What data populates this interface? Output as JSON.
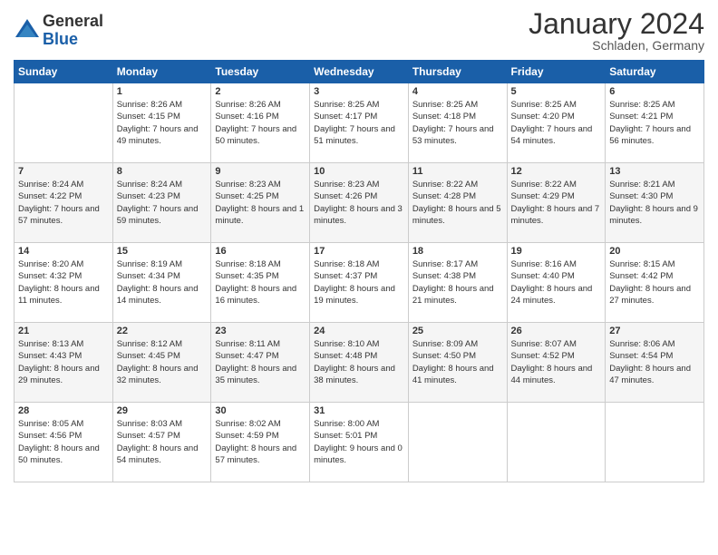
{
  "logo": {
    "general": "General",
    "blue": "Blue"
  },
  "header": {
    "month": "January 2024",
    "location": "Schladen, Germany"
  },
  "weekdays": [
    "Sunday",
    "Monday",
    "Tuesday",
    "Wednesday",
    "Thursday",
    "Friday",
    "Saturday"
  ],
  "weeks": [
    [
      {
        "day": "",
        "sunrise": "",
        "sunset": "",
        "daylight": ""
      },
      {
        "day": "1",
        "sunrise": "Sunrise: 8:26 AM",
        "sunset": "Sunset: 4:15 PM",
        "daylight": "Daylight: 7 hours and 49 minutes."
      },
      {
        "day": "2",
        "sunrise": "Sunrise: 8:26 AM",
        "sunset": "Sunset: 4:16 PM",
        "daylight": "Daylight: 7 hours and 50 minutes."
      },
      {
        "day": "3",
        "sunrise": "Sunrise: 8:25 AM",
        "sunset": "Sunset: 4:17 PM",
        "daylight": "Daylight: 7 hours and 51 minutes."
      },
      {
        "day": "4",
        "sunrise": "Sunrise: 8:25 AM",
        "sunset": "Sunset: 4:18 PM",
        "daylight": "Daylight: 7 hours and 53 minutes."
      },
      {
        "day": "5",
        "sunrise": "Sunrise: 8:25 AM",
        "sunset": "Sunset: 4:20 PM",
        "daylight": "Daylight: 7 hours and 54 minutes."
      },
      {
        "day": "6",
        "sunrise": "Sunrise: 8:25 AM",
        "sunset": "Sunset: 4:21 PM",
        "daylight": "Daylight: 7 hours and 56 minutes."
      }
    ],
    [
      {
        "day": "7",
        "sunrise": "Sunrise: 8:24 AM",
        "sunset": "Sunset: 4:22 PM",
        "daylight": "Daylight: 7 hours and 57 minutes."
      },
      {
        "day": "8",
        "sunrise": "Sunrise: 8:24 AM",
        "sunset": "Sunset: 4:23 PM",
        "daylight": "Daylight: 7 hours and 59 minutes."
      },
      {
        "day": "9",
        "sunrise": "Sunrise: 8:23 AM",
        "sunset": "Sunset: 4:25 PM",
        "daylight": "Daylight: 8 hours and 1 minute."
      },
      {
        "day": "10",
        "sunrise": "Sunrise: 8:23 AM",
        "sunset": "Sunset: 4:26 PM",
        "daylight": "Daylight: 8 hours and 3 minutes."
      },
      {
        "day": "11",
        "sunrise": "Sunrise: 8:22 AM",
        "sunset": "Sunset: 4:28 PM",
        "daylight": "Daylight: 8 hours and 5 minutes."
      },
      {
        "day": "12",
        "sunrise": "Sunrise: 8:22 AM",
        "sunset": "Sunset: 4:29 PM",
        "daylight": "Daylight: 8 hours and 7 minutes."
      },
      {
        "day": "13",
        "sunrise": "Sunrise: 8:21 AM",
        "sunset": "Sunset: 4:30 PM",
        "daylight": "Daylight: 8 hours and 9 minutes."
      }
    ],
    [
      {
        "day": "14",
        "sunrise": "Sunrise: 8:20 AM",
        "sunset": "Sunset: 4:32 PM",
        "daylight": "Daylight: 8 hours and 11 minutes."
      },
      {
        "day": "15",
        "sunrise": "Sunrise: 8:19 AM",
        "sunset": "Sunset: 4:34 PM",
        "daylight": "Daylight: 8 hours and 14 minutes."
      },
      {
        "day": "16",
        "sunrise": "Sunrise: 8:18 AM",
        "sunset": "Sunset: 4:35 PM",
        "daylight": "Daylight: 8 hours and 16 minutes."
      },
      {
        "day": "17",
        "sunrise": "Sunrise: 8:18 AM",
        "sunset": "Sunset: 4:37 PM",
        "daylight": "Daylight: 8 hours and 19 minutes."
      },
      {
        "day": "18",
        "sunrise": "Sunrise: 8:17 AM",
        "sunset": "Sunset: 4:38 PM",
        "daylight": "Daylight: 8 hours and 21 minutes."
      },
      {
        "day": "19",
        "sunrise": "Sunrise: 8:16 AM",
        "sunset": "Sunset: 4:40 PM",
        "daylight": "Daylight: 8 hours and 24 minutes."
      },
      {
        "day": "20",
        "sunrise": "Sunrise: 8:15 AM",
        "sunset": "Sunset: 4:42 PM",
        "daylight": "Daylight: 8 hours and 27 minutes."
      }
    ],
    [
      {
        "day": "21",
        "sunrise": "Sunrise: 8:13 AM",
        "sunset": "Sunset: 4:43 PM",
        "daylight": "Daylight: 8 hours and 29 minutes."
      },
      {
        "day": "22",
        "sunrise": "Sunrise: 8:12 AM",
        "sunset": "Sunset: 4:45 PM",
        "daylight": "Daylight: 8 hours and 32 minutes."
      },
      {
        "day": "23",
        "sunrise": "Sunrise: 8:11 AM",
        "sunset": "Sunset: 4:47 PM",
        "daylight": "Daylight: 8 hours and 35 minutes."
      },
      {
        "day": "24",
        "sunrise": "Sunrise: 8:10 AM",
        "sunset": "Sunset: 4:48 PM",
        "daylight": "Daylight: 8 hours and 38 minutes."
      },
      {
        "day": "25",
        "sunrise": "Sunrise: 8:09 AM",
        "sunset": "Sunset: 4:50 PM",
        "daylight": "Daylight: 8 hours and 41 minutes."
      },
      {
        "day": "26",
        "sunrise": "Sunrise: 8:07 AM",
        "sunset": "Sunset: 4:52 PM",
        "daylight": "Daylight: 8 hours and 44 minutes."
      },
      {
        "day": "27",
        "sunrise": "Sunrise: 8:06 AM",
        "sunset": "Sunset: 4:54 PM",
        "daylight": "Daylight: 8 hours and 47 minutes."
      }
    ],
    [
      {
        "day": "28",
        "sunrise": "Sunrise: 8:05 AM",
        "sunset": "Sunset: 4:56 PM",
        "daylight": "Daylight: 8 hours and 50 minutes."
      },
      {
        "day": "29",
        "sunrise": "Sunrise: 8:03 AM",
        "sunset": "Sunset: 4:57 PM",
        "daylight": "Daylight: 8 hours and 54 minutes."
      },
      {
        "day": "30",
        "sunrise": "Sunrise: 8:02 AM",
        "sunset": "Sunset: 4:59 PM",
        "daylight": "Daylight: 8 hours and 57 minutes."
      },
      {
        "day": "31",
        "sunrise": "Sunrise: 8:00 AM",
        "sunset": "Sunset: 5:01 PM",
        "daylight": "Daylight: 9 hours and 0 minutes."
      },
      {
        "day": "",
        "sunrise": "",
        "sunset": "",
        "daylight": ""
      },
      {
        "day": "",
        "sunrise": "",
        "sunset": "",
        "daylight": ""
      },
      {
        "day": "",
        "sunrise": "",
        "sunset": "",
        "daylight": ""
      }
    ]
  ]
}
